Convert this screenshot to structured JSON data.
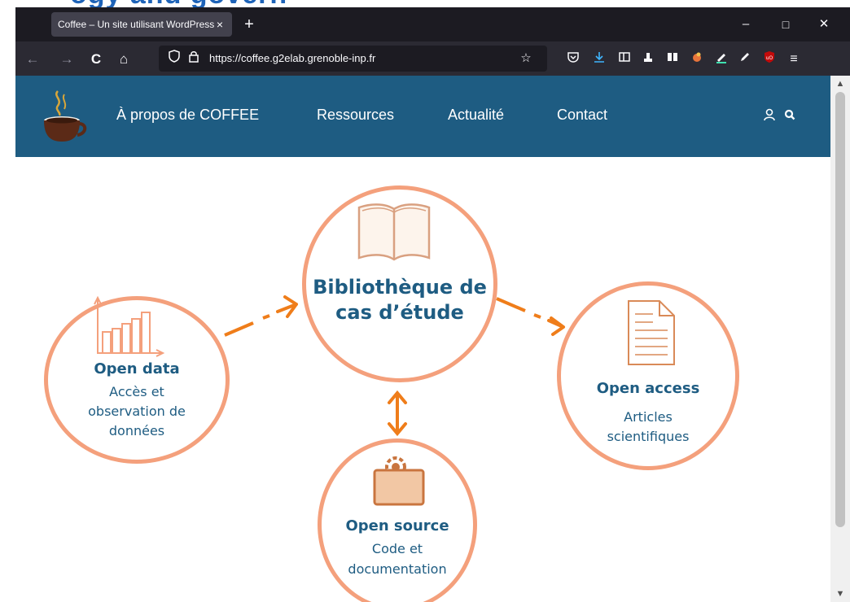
{
  "browser": {
    "tab_title": "Coffee – Un site utilisant WordPress",
    "tab_close": "×",
    "new_tab": "+",
    "url": "https://coffee.g2elab.grenoble-inp.fr",
    "controls": {
      "minimize": "–",
      "maximize": "□",
      "close": "✕"
    },
    "nav_icons": {
      "back": "←",
      "forward": "→",
      "reload": "C",
      "home": "⌂"
    },
    "toolbar_icons": [
      "pocket-icon",
      "downloads-icon",
      "sidebar-icon",
      "ext-icon",
      "reader-icon",
      "ext-icon",
      "ext-icon",
      "ext-icon",
      "ublock-icon",
      "menu-icon"
    ]
  },
  "site": {
    "nav": [
      "À propos de COFFEE",
      "Ressources",
      "Actualité",
      "Contact"
    ],
    "header_color": "#1e5c82",
    "accent_color": "#f4a07c",
    "arrow_color": "#ef7d1a"
  },
  "diagram": {
    "center": {
      "title_line1": "Bibliothèque de",
      "title_line2": "cas d’étude"
    },
    "open_data": {
      "title": "Open data",
      "line1": "Accès et",
      "line2": "observation de",
      "line3": "données"
    },
    "open_access": {
      "title": "Open access",
      "line1": "Articles",
      "line2": "scientifiques"
    },
    "open_source": {
      "title": "Open source",
      "line1": "Code et",
      "line2": "documentation"
    }
  }
}
